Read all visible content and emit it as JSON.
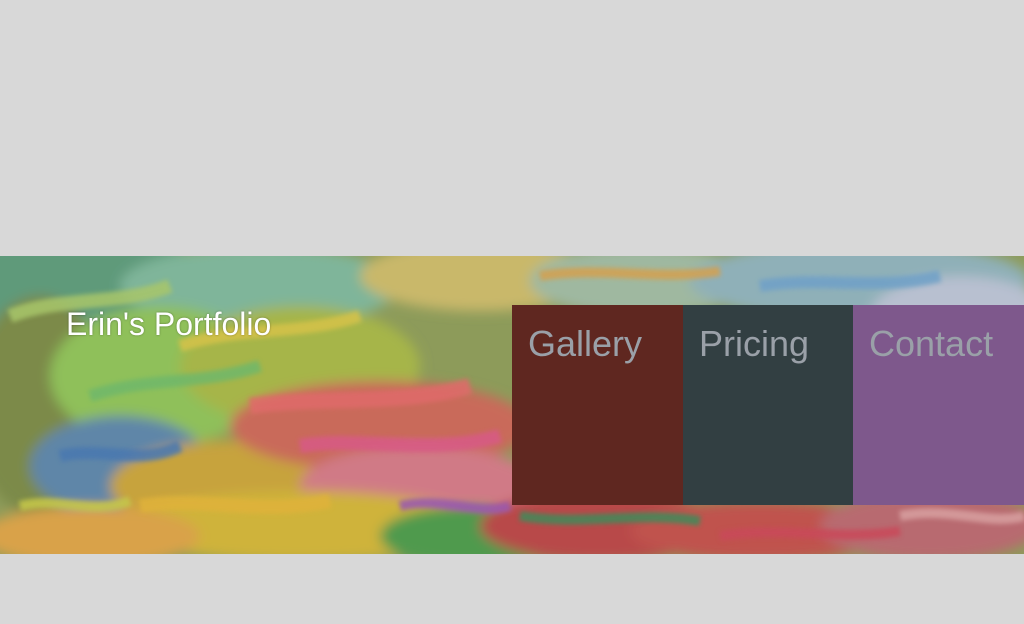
{
  "header": {
    "title": "Erin's Portfolio"
  },
  "nav": {
    "items": [
      {
        "label": "Gallery",
        "color": "#5f2720",
        "text_color": "#9aa0a8"
      },
      {
        "label": "Pricing",
        "color": "#323f42",
        "text_color": "#9aa0a8"
      },
      {
        "label": "Contact",
        "color": "#7e588c",
        "text_color": "#9aa0a8"
      }
    ]
  },
  "colors": {
    "page_background": "#d8d8d8",
    "title_text": "#ffffff"
  }
}
